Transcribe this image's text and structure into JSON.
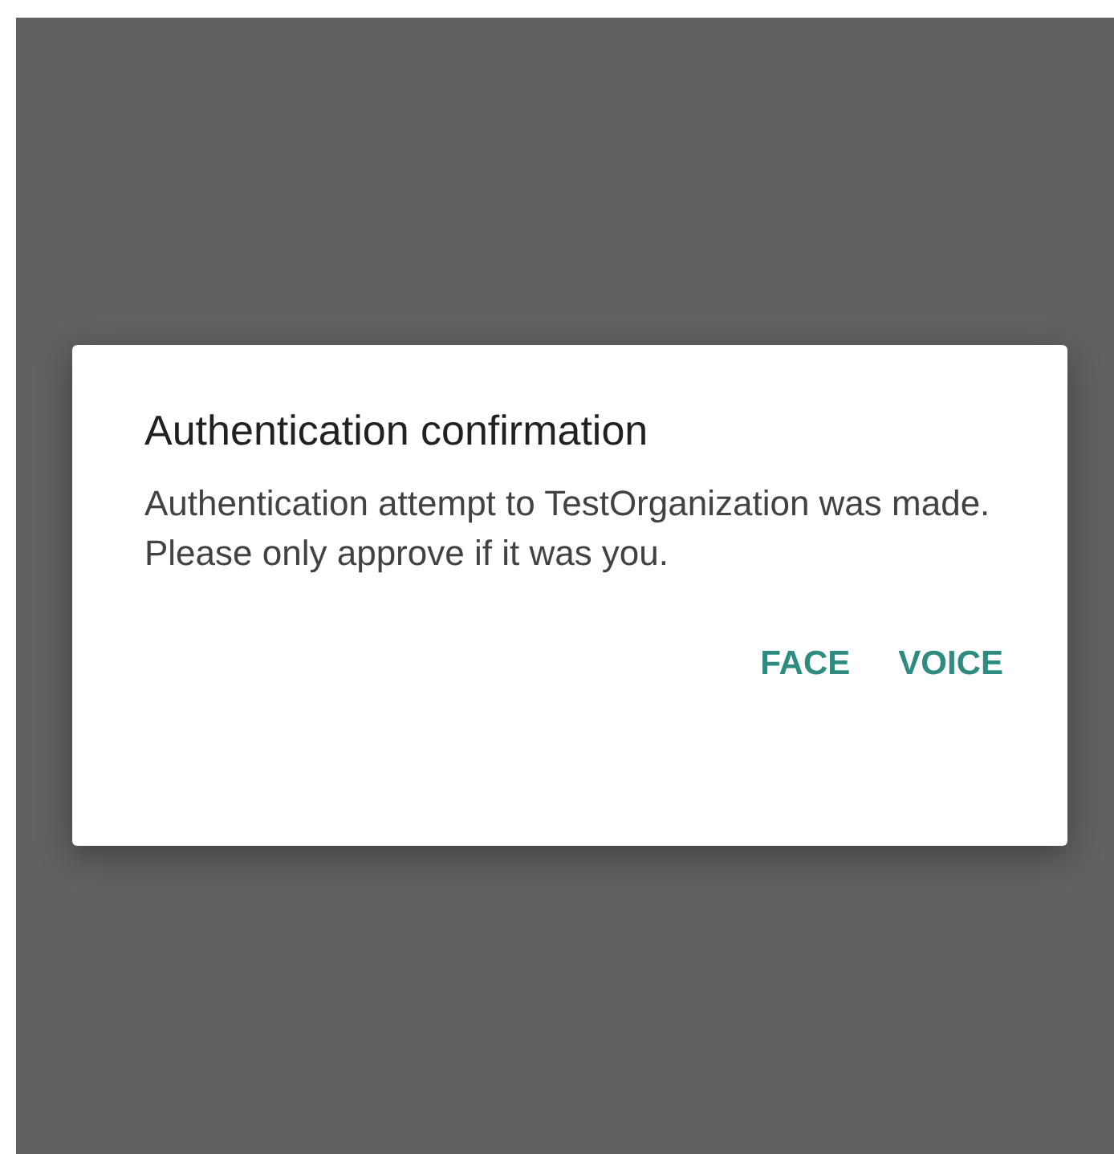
{
  "dialog": {
    "title": "Authentication confirmation",
    "message": "Authentication attempt to TestOrganization was made. Please only approve if it was you.",
    "buttons": [
      "FACE",
      "VOICE"
    ]
  }
}
